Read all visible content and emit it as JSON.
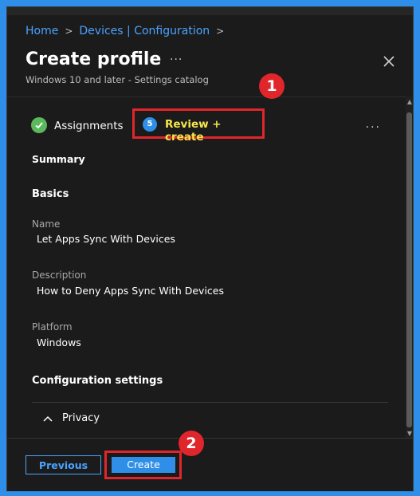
{
  "breadcrumb": {
    "home": "Home",
    "devices": "Devices | Configuration",
    "sep": ">"
  },
  "header": {
    "title": "Create profile",
    "more": "···",
    "subtitle": "Windows 10 and later - Settings catalog"
  },
  "tabs": [
    {
      "label": "Assignments",
      "state": "complete"
    },
    {
      "label": "Review + create",
      "state": "current",
      "step": "5"
    }
  ],
  "tabs_more": "···",
  "annotations": {
    "one": "1",
    "two": "2"
  },
  "summary": {
    "heading": "Summary",
    "basics_heading": "Basics",
    "name_label": "Name",
    "name_value": "Let Apps Sync With Devices",
    "description_label": "Description",
    "description_value": "How to Deny Apps Sync With Devices",
    "platform_label": "Platform",
    "platform_value": "Windows",
    "config_heading": "Configuration settings",
    "privacy_label": "Privacy",
    "privacy_chevron": "^"
  },
  "footer": {
    "previous": "Previous",
    "create": "Create"
  },
  "colors": {
    "accent": "#2f8fe8",
    "highlight": "#e0262b",
    "link": "#4aa3ff",
    "current_tab_text": "#f7e84a"
  }
}
